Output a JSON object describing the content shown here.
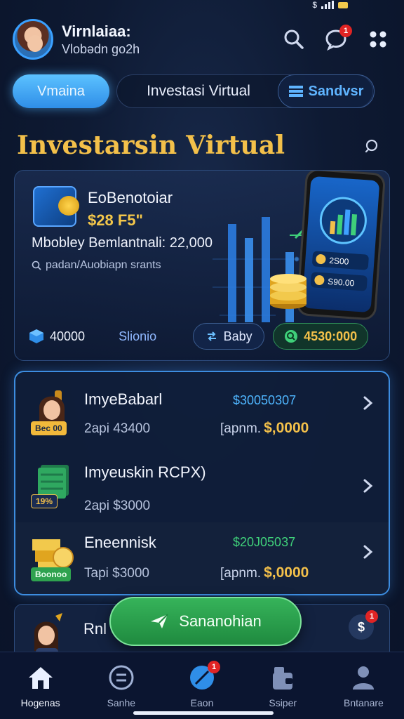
{
  "header": {
    "user_name": "Virnlaiaa:",
    "user_sub": "Vlobədn go2h",
    "notification_count": "1"
  },
  "tabs": {
    "active": "Vmaina",
    "second": "Investasi Virtual",
    "third": "Sandvsr"
  },
  "section_title": "Investarsin Virtual",
  "hero": {
    "title": "EoBenotoiar",
    "amount": "$28 F5\"",
    "line1": "Mbobley Bemlantnali: 22,000",
    "line2": "padan/Auobiapn srants",
    "foot_value": "40000",
    "foot_mid": "Slionio",
    "buy_label": "Baby",
    "price_label": "4530:000",
    "phone_line1": "2S00",
    "phone_line2": "S90.00"
  },
  "list": [
    {
      "name": "ImyeBabarl",
      "rate": "$30050307",
      "tag": "Bec 00",
      "sub": "2api 43400",
      "right_label": "[apnm.",
      "right_value": "$,0000",
      "colors": {
        "tag_bg": "#f2b93b",
        "tag_fg": "#1d2a44"
      }
    },
    {
      "name": "Imyeuskin RCPX)",
      "rate": "",
      "tag": "19%",
      "sub": "2api $3000",
      "right_label": "",
      "right_value": "",
      "colors": {
        "tag_bg": "#1a2c52",
        "tag_fg": "#f3c04a"
      }
    },
    {
      "name": "Eneennisk",
      "rate": "$20J05037",
      "tag": "Boonoo",
      "sub": "Tapi $3000",
      "right_label": "[apnm.",
      "right_value": "$,0000",
      "colors": {
        "tag_bg": "#2fa24f",
        "tag_fg": "#eaffef"
      }
    }
  ],
  "partial": {
    "name": "Rnl",
    "badge": "1"
  },
  "fab_label": "Sananohian",
  "nav": [
    {
      "label": "Hogenas",
      "icon": "home-icon"
    },
    {
      "label": "Sanhe",
      "icon": "coin-icon"
    },
    {
      "label": "Eaon",
      "icon": "rocket-icon",
      "badge": "1"
    },
    {
      "label": "Ssiper",
      "icon": "wallet-icon"
    },
    {
      "label": "Bntanare",
      "icon": "profile-icon"
    }
  ],
  "colors": {
    "accent_blue": "#3aa0ff",
    "gold": "#f3c04a",
    "green": "#2fa24f",
    "background": "#0e1a33"
  }
}
